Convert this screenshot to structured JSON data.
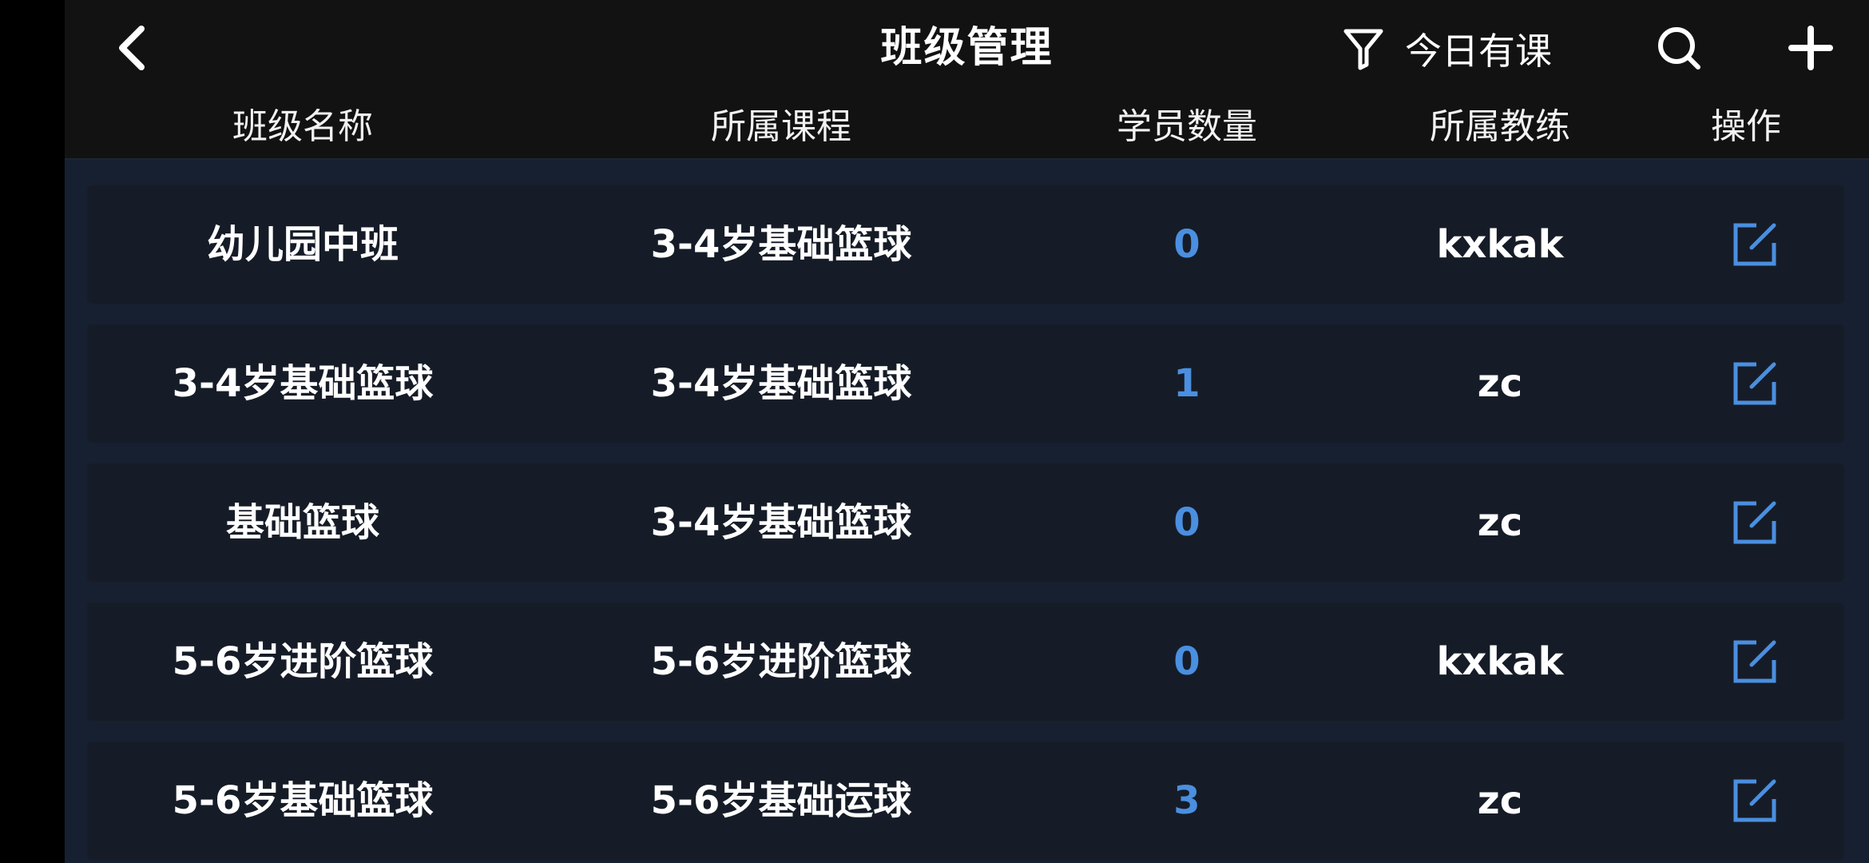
{
  "header": {
    "title": "班级管理",
    "back_icon": "chevron-left-icon",
    "filter_label": "今日有课",
    "filter_icon": "filter-icon",
    "search_icon": "search-icon",
    "add_icon": "plus-icon"
  },
  "columns": [
    "班级名称",
    "所属课程",
    "学员数量",
    "所属教练",
    "操作"
  ],
  "rows": [
    {
      "name": "幼儿园中班",
      "course": "3-4岁基础篮球",
      "count": "0",
      "coach": "kxkak"
    },
    {
      "name": "3-4岁基础篮球",
      "course": "3-4岁基础篮球",
      "count": "1",
      "coach": "zc"
    },
    {
      "name": "基础篮球",
      "course": "3-4岁基础篮球",
      "count": "0",
      "coach": "zc"
    },
    {
      "name": "5-6岁进阶篮球",
      "course": "5-6岁进阶篮球",
      "count": "0",
      "coach": "kxkak"
    },
    {
      "name": "5-6岁基础篮球",
      "course": "5-6岁基础运球",
      "count": "3",
      "coach": "zc"
    }
  ],
  "row_action_icon": "edit-icon",
  "colors": {
    "accent": "#4a8fe0",
    "background": "#141924",
    "header_background": "#121212",
    "row_background": "#161c27",
    "text": "#ffffff"
  }
}
